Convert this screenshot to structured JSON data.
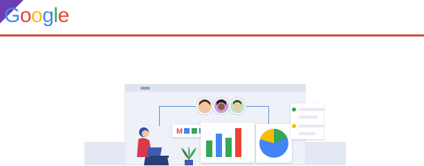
{
  "brand": {
    "name": "Google",
    "letter_colors": [
      "#4285F4",
      "#EA4335",
      "#FBBC05",
      "#4285F4",
      "#34A853",
      "#EA4335"
    ]
  },
  "colors": {
    "corner": "#6b3fb0",
    "divider": "#d9453b"
  },
  "illustration": {
    "card_letters": "M■■■",
    "bar_colors": [
      "#34A853",
      "#4285F4",
      "#34A853",
      "#EA4335"
    ],
    "pie_colors": [
      "#4285F4",
      "#FBBC05",
      "#34A853"
    ],
    "icons": [
      "people-avatars",
      "bar-chart",
      "pie-chart",
      "person-with-laptop",
      "plant",
      "browser-window"
    ]
  }
}
